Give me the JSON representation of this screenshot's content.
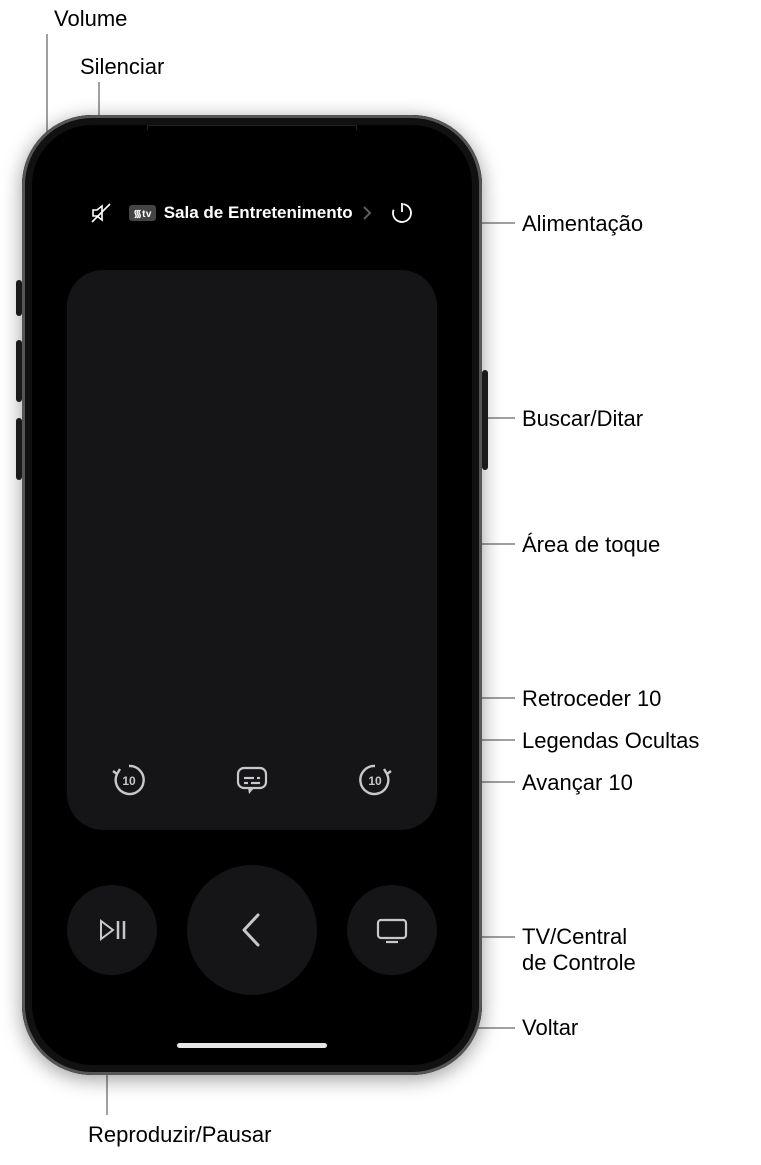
{
  "callouts": {
    "volume": "Volume",
    "mute": "Silenciar",
    "power": "Alimentação",
    "search_dictate": "Buscar/Ditar",
    "touch_area": "Área de toque",
    "rewind10": "Retroceder 10",
    "captions": "Legendas Ocultas",
    "forward10": "Avançar 10",
    "tv_control_center_line1": "TV/Central",
    "tv_control_center_line2": "de Controle",
    "back": "Voltar",
    "play_pause": "Reproduzir/Pausar"
  },
  "remote": {
    "device_tag": "᯾tv",
    "room_name": "Sala de Entretenimento",
    "skip_seconds": "10"
  }
}
